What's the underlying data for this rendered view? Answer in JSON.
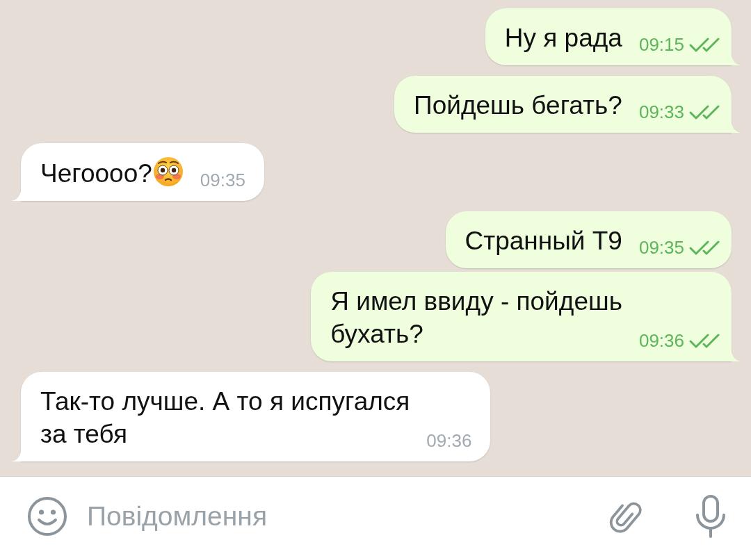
{
  "messages": [
    {
      "kind": "outgoing",
      "text": "Ну я рада",
      "emoji": false,
      "time": "09:15",
      "read": true,
      "tail": true
    },
    {
      "kind": "outgoing",
      "text": "Пойдешь бегать?",
      "emoji": false,
      "time": "09:33",
      "read": true,
      "tail": true
    },
    {
      "kind": "incoming",
      "text": "Чегоооо?",
      "emoji": true,
      "time": "09:35",
      "tail": true
    },
    {
      "kind": "outgoing",
      "text": "Странный Т9",
      "emoji": false,
      "time": "09:35",
      "read": true,
      "tail": false
    },
    {
      "kind": "outgoing",
      "text": "Я имел ввиду - пойдешь\nбухать?",
      "emoji": false,
      "time": "09:36",
      "read": true,
      "tail": true
    },
    {
      "kind": "incoming",
      "text": "Так-то лучше. А то я испугался\nза тебя",
      "emoji": false,
      "time": "09:36",
      "tail": true
    }
  ],
  "composer": {
    "placeholder": "Повідомлення"
  }
}
